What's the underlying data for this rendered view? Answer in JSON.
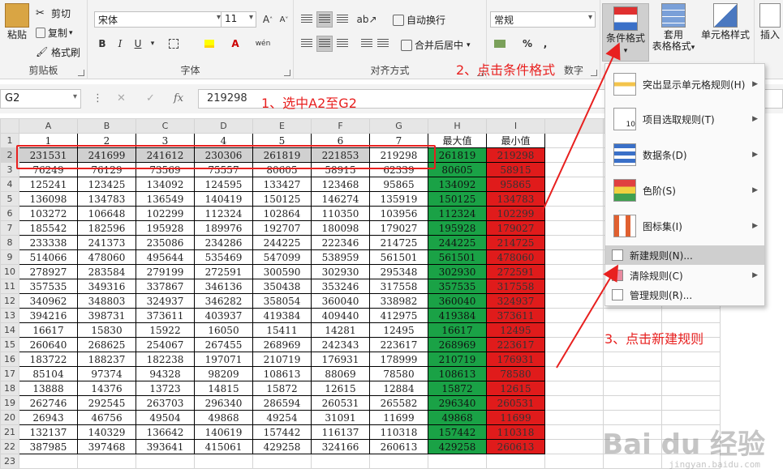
{
  "ribbon": {
    "clipboard": {
      "paste": "粘贴",
      "cut": "剪切",
      "copy": "复制",
      "format_painter": "格式刷",
      "title": "剪贴板"
    },
    "font": {
      "font_name": "宋体",
      "font_size": "11",
      "bold": "B",
      "italic": "I",
      "underline": "U",
      "title": "字体"
    },
    "alignment": {
      "wrap_text": "自动换行",
      "merge_center": "合并后居中",
      "title": "对齐方式"
    },
    "number": {
      "format": "常规",
      "percent": "%",
      "comma": ",",
      "title": "数字"
    },
    "styles": {
      "conditional_formatting": "条件格式",
      "format_as_table_1": "套用",
      "format_as_table_2": "表格格式",
      "cell_styles": "单元格样式"
    },
    "cells": {
      "insert": "插入"
    }
  },
  "formula_bar": {
    "name_box": "G2",
    "cancel": "✕",
    "enter": "✓",
    "fx": "fx",
    "value": "219298"
  },
  "grid": {
    "col_headers": [
      "A",
      "B",
      "C",
      "D",
      "E",
      "F",
      "G",
      "H",
      "I"
    ],
    "row_numbers": [
      "1",
      "2",
      "3",
      "4",
      "5",
      "6",
      "7",
      "8",
      "9",
      "10",
      "11",
      "12",
      "13",
      "14",
      "15",
      "16",
      "17",
      "18",
      "19",
      "20",
      "21",
      "22",
      "23"
    ],
    "header_row": [
      "1",
      "2",
      "3",
      "4",
      "5",
      "6",
      "7",
      "最大值",
      "最小值"
    ],
    "rows": [
      [
        "231531",
        "241699",
        "241612",
        "230306",
        "261819",
        "221853",
        "219298",
        "261819",
        "219298"
      ],
      [
        "76249",
        "76129",
        "73569",
        "75557",
        "80605",
        "58915",
        "62339",
        "80605",
        "58915"
      ],
      [
        "125241",
        "123425",
        "134092",
        "124595",
        "133427",
        "123468",
        "95865",
        "134092",
        "95865"
      ],
      [
        "136098",
        "134783",
        "136549",
        "140419",
        "150125",
        "146274",
        "135919",
        "150125",
        "134783"
      ],
      [
        "103272",
        "106648",
        "102299",
        "112324",
        "102864",
        "110350",
        "103956",
        "112324",
        "102299"
      ],
      [
        "185542",
        "182596",
        "195928",
        "189976",
        "192707",
        "180098",
        "179027",
        "195928",
        "179027"
      ],
      [
        "233338",
        "241373",
        "235086",
        "234286",
        "244225",
        "222346",
        "214725",
        "244225",
        "214725"
      ],
      [
        "514066",
        "478060",
        "495644",
        "535469",
        "547099",
        "538959",
        "561501",
        "561501",
        "478060"
      ],
      [
        "278927",
        "283584",
        "279199",
        "272591",
        "300590",
        "302930",
        "295348",
        "302930",
        "272591"
      ],
      [
        "357535",
        "349316",
        "337867",
        "346136",
        "350438",
        "353246",
        "317558",
        "357535",
        "317558"
      ],
      [
        "340962",
        "348803",
        "324937",
        "346282",
        "358054",
        "360040",
        "338982",
        "360040",
        "324937"
      ],
      [
        "394216",
        "398731",
        "373611",
        "403937",
        "419384",
        "409440",
        "412975",
        "419384",
        "373611"
      ],
      [
        "16617",
        "15830",
        "15922",
        "16050",
        "15411",
        "14281",
        "12495",
        "16617",
        "12495"
      ],
      [
        "260640",
        "268625",
        "254067",
        "267455",
        "268969",
        "242343",
        "223617",
        "268969",
        "223617"
      ],
      [
        "183722",
        "188237",
        "182238",
        "197071",
        "210719",
        "176931",
        "178999",
        "210719",
        "176931"
      ],
      [
        "85104",
        "97374",
        "94328",
        "98209",
        "108613",
        "88069",
        "78580",
        "108613",
        "78580"
      ],
      [
        "13888",
        "14376",
        "13723",
        "14815",
        "15872",
        "12615",
        "12884",
        "15872",
        "12615"
      ],
      [
        "262746",
        "292545",
        "263703",
        "296340",
        "286594",
        "260531",
        "265582",
        "296340",
        "260531"
      ],
      [
        "26943",
        "46756",
        "49504",
        "49868",
        "49254",
        "31091",
        "11699",
        "49868",
        "11699"
      ],
      [
        "132137",
        "140329",
        "136642",
        "140619",
        "157442",
        "116137",
        "110318",
        "157442",
        "110318"
      ],
      [
        "387985",
        "397468",
        "393641",
        "415061",
        "429258",
        "324166",
        "260613",
        "429258",
        "260613"
      ]
    ]
  },
  "menu": {
    "items": [
      {
        "label": "突出显示单元格规则(H)",
        "icon": "highlight-rules-icon"
      },
      {
        "label": "项目选取规则(T)",
        "icon": "top-bottom-rules-icon"
      },
      {
        "label": "数据条(D)",
        "icon": "data-bars-icon"
      },
      {
        "label": "色阶(S)",
        "icon": "color-scales-icon"
      },
      {
        "label": "图标集(I)",
        "icon": "icon-sets-icon"
      }
    ],
    "small_items": [
      {
        "label": "新建规则(N)...",
        "icon": "new-rule-icon"
      },
      {
        "label": "清除规则(C)",
        "icon": "clear-rules-icon"
      },
      {
        "label": "管理规则(R)...",
        "icon": "manage-rules-icon"
      }
    ]
  },
  "annotations": {
    "step1": "1、选中A2至G2",
    "step2": "2、点击条件格式",
    "step3": "3、点击新建规则",
    "color": "#e8201f"
  },
  "colors": {
    "max_fill": "#1aa246",
    "min_fill": "#e01b1b"
  },
  "watermark": {
    "brand": "Bai du 经验",
    "url": "jingyan.baidu.com"
  }
}
